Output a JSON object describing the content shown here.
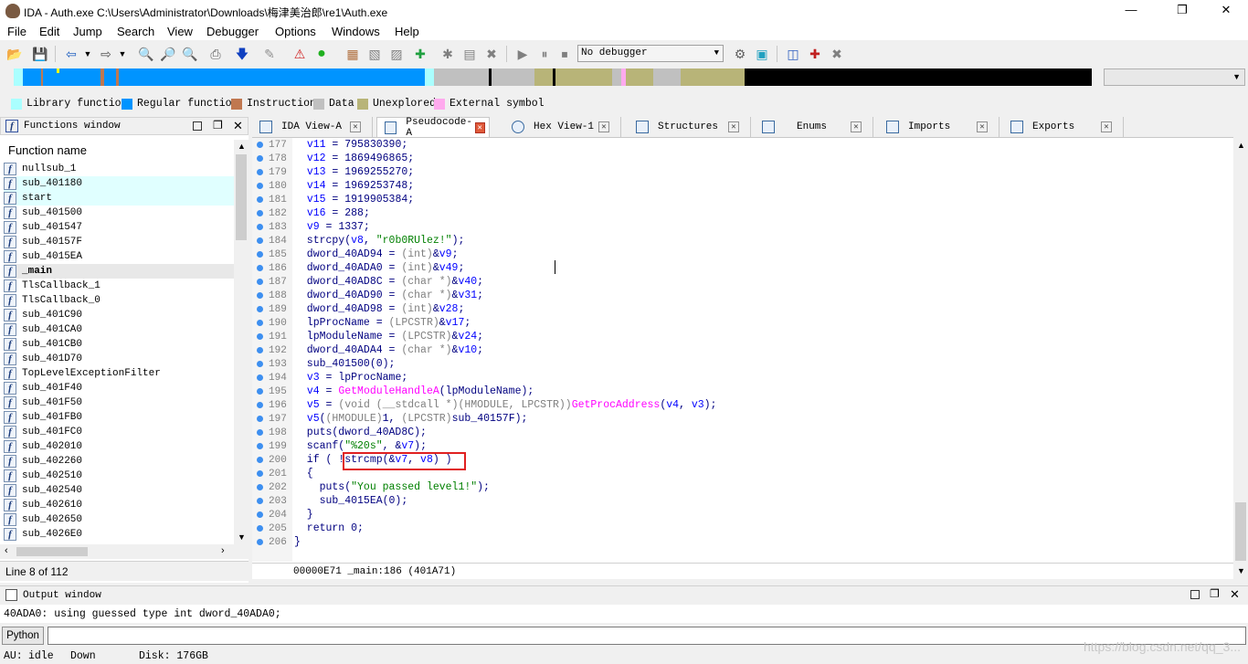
{
  "window": {
    "title": "IDA - Auth.exe C:\\Users\\Administrator\\Downloads\\梅津美治郎\\re1\\Auth.exe",
    "minimize": "—",
    "maximize": "❐",
    "close": "✕"
  },
  "menu": [
    "File",
    "Edit",
    "Jump",
    "Search",
    "View",
    "Debugger",
    "Options",
    "Windows",
    "Help"
  ],
  "toolbar": {
    "debugger": "No debugger"
  },
  "legend": [
    {
      "label": "Library function",
      "color": "#aaffff"
    },
    {
      "label": "Regular function",
      "color": "#0094ff"
    },
    {
      "label": "Instruction",
      "color": "#c07850"
    },
    {
      "label": "Data",
      "color": "#c0c0c0"
    },
    {
      "label": "Unexplored",
      "color": "#b8b478"
    },
    {
      "label": "External symbol",
      "color": "#ffaaee"
    }
  ],
  "functions_window": {
    "title": "Functions window",
    "column": "Function name",
    "items": [
      "nullsub_1",
      "sub_401180",
      "start",
      "sub_401500",
      "sub_401547",
      "sub_40157F",
      "sub_4015EA",
      "_main",
      "TlsCallback_1",
      "TlsCallback_0",
      "sub_401C90",
      "sub_401CA0",
      "sub_401CB0",
      "sub_401D70",
      "TopLevelExceptionFilter",
      "sub_401F40",
      "sub_401F50",
      "sub_401FB0",
      "sub_401FC0",
      "sub_402010",
      "sub_402260",
      "sub_402510",
      "sub_402540",
      "sub_402610",
      "sub_402650",
      "sub_4026E0"
    ],
    "status": "Line 8 of 112"
  },
  "tabs": [
    {
      "label": "IDA View-A"
    },
    {
      "label": "Pseudocode-A"
    },
    {
      "label": "Hex View-1"
    },
    {
      "label": "Structures"
    },
    {
      "label": "Enums"
    },
    {
      "label": "Imports"
    },
    {
      "label": "Exports"
    }
  ],
  "line_numbers": [
    "177",
    "178",
    "179",
    "180",
    "181",
    "182",
    "183",
    "184",
    "185",
    "186",
    "187",
    "188",
    "189",
    "190",
    "191",
    "192",
    "193",
    "194",
    "195",
    "196",
    "197",
    "198",
    "199",
    "200",
    "201",
    "202",
    "203",
    "204",
    "205",
    "206"
  ],
  "code_status": "00000E71 _main:186 (401A71)",
  "output": {
    "title": "Output window",
    "text": "40ADA0: using guessed type int dword_40ADA0;"
  },
  "python_label": "Python",
  "statusbar": {
    "au": "AU:",
    "state": "idle",
    "direction": "Down",
    "disk": "Disk: 176GB"
  },
  "watermark": "https://blog.csdn.net/qq_3..."
}
